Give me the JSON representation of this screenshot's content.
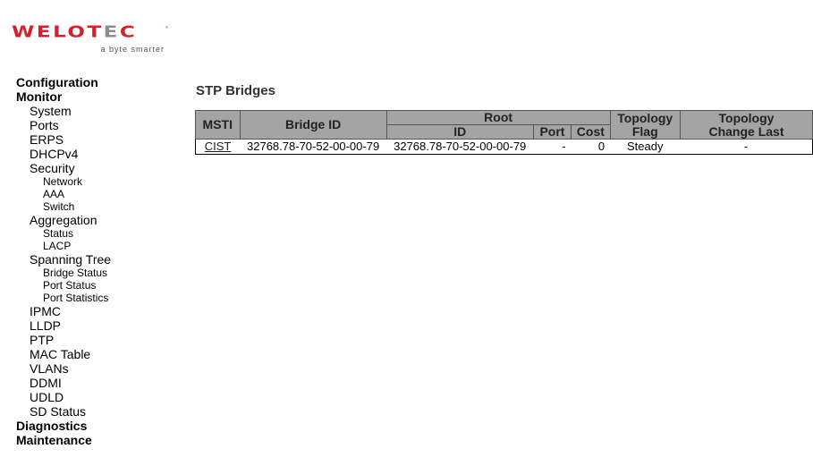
{
  "logo": {
    "brand_main": "WELOT",
    "brand_accent": "E",
    "brand_end": "C",
    "registered": "®",
    "tagline": "a byte smarter"
  },
  "nav": [
    {
      "label": "Configuration",
      "level": 0
    },
    {
      "label": "Monitor",
      "level": 0
    },
    {
      "label": "System",
      "level": 1
    },
    {
      "label": "Ports",
      "level": 1
    },
    {
      "label": "ERPS",
      "level": 1
    },
    {
      "label": "DHCPv4",
      "level": 1
    },
    {
      "label": "Security",
      "level": 1
    },
    {
      "label": "Network",
      "level": 2
    },
    {
      "label": "AAA",
      "level": 2
    },
    {
      "label": "Switch",
      "level": 2
    },
    {
      "label": "Aggregation",
      "level": 1
    },
    {
      "label": "Status",
      "level": 2
    },
    {
      "label": "LACP",
      "level": 2
    },
    {
      "label": "Spanning Tree",
      "level": 1
    },
    {
      "label": "Bridge Status",
      "level": 2
    },
    {
      "label": "Port Status",
      "level": 2
    },
    {
      "label": "Port Statistics",
      "level": 2
    },
    {
      "label": "IPMC",
      "level": 1
    },
    {
      "label": "LLDP",
      "level": 1
    },
    {
      "label": "PTP",
      "level": 1
    },
    {
      "label": "MAC Table",
      "level": 1
    },
    {
      "label": "VLANs",
      "level": 1
    },
    {
      "label": "DDMI",
      "level": 1
    },
    {
      "label": "UDLD",
      "level": 1
    },
    {
      "label": "SD Status",
      "level": 1
    },
    {
      "label": "Diagnostics",
      "level": 0
    },
    {
      "label": "Maintenance",
      "level": 0
    }
  ],
  "page": {
    "title": "STP Bridges",
    "table": {
      "headers": {
        "msti": "MSTI",
        "bridge_id": "Bridge ID",
        "root": "Root",
        "root_id": "ID",
        "root_port": "Port",
        "root_cost": "Cost",
        "topology_flag": "Topology Flag",
        "topology_change_last": "Topology Change Last"
      },
      "rows": [
        {
          "msti": "CIST",
          "bridge_id": "32768.78-70-52-00-00-79",
          "root_id": "32768.78-70-52-00-00-79",
          "root_port": "-",
          "root_cost": "0",
          "topology_flag": "Steady",
          "topology_change_last": "-"
        }
      ]
    }
  }
}
